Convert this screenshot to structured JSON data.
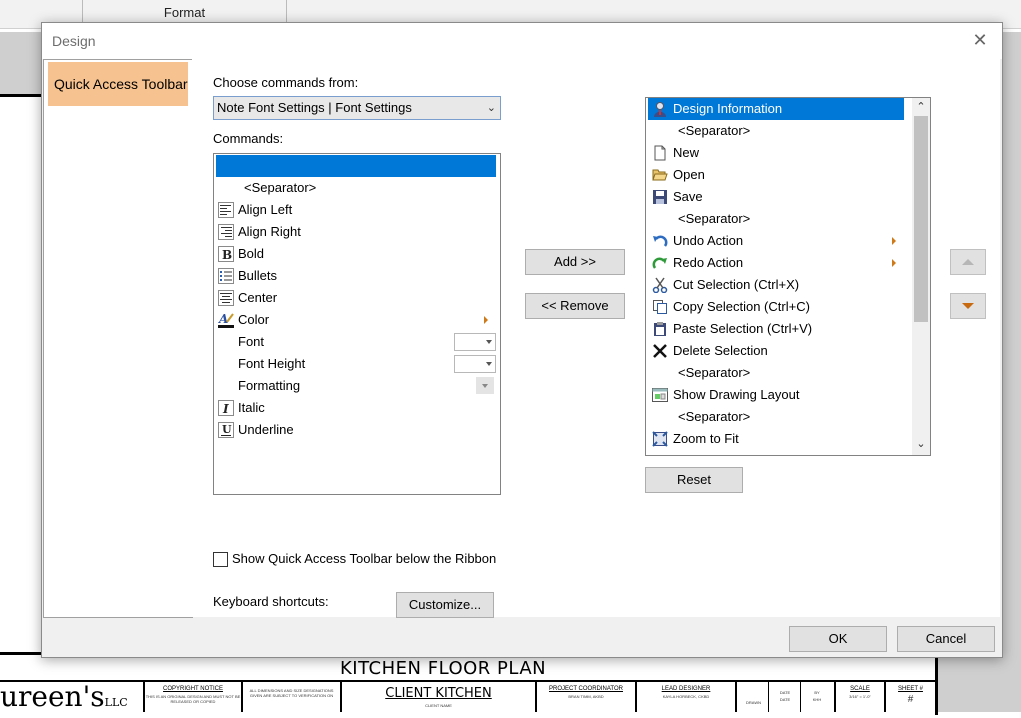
{
  "background": {
    "ribbon_tab": "Format",
    "title_block": {
      "sheet_title": "KITCHEN FLOOR PLAN",
      "logo": "ureen's",
      "logo_suffix": "LLC",
      "copyright_heading": "COPYRIGHT NOTICE",
      "copyright_text": "THIS IS AN ORIGINAL DESIGN AND MUST NOT BE RELEASED OR COPIED",
      "dimensions_text": "ALL DIMENSIONS AND SIZE DESIGNATIONS GIVEN ARE SUBJECT TO VERIFICATION ON",
      "client_name": "CLIENT KITCHEN",
      "client_caption": "CLIENT NAME",
      "coordinator_heading": "PROJECT COORDINATOR",
      "coordinator_name": "BRAN TIMM, AKBD",
      "designer_heading": "LEAD DESIGNER",
      "designer_name": "KAYLA HORBECK, CKBD",
      "date_heading": "DATE",
      "by_heading": "BY",
      "drawn_label": "DRAWN",
      "date_value": "DATE",
      "by_value": "KHH",
      "scale_heading": "SCALE",
      "scale_value": "3/16\" = 1'-0\"",
      "sheet_heading": "SHEET #",
      "sheet_value": "#"
    }
  },
  "dialog": {
    "title": "Design",
    "close_icon": "close-icon",
    "nav": {
      "quick_access_toolbar": "Quick Access Toolbar"
    },
    "choose_commands_label": "Choose commands from:",
    "choose_commands_value": "Note Font Settings | Font Settings",
    "commands_label": "Commands:",
    "commands": [
      {
        "label": "",
        "icon": "",
        "selected": true
      },
      {
        "label": "<Separator>",
        "icon": ""
      },
      {
        "label": "Align Left",
        "icon": "align-left-icon"
      },
      {
        "label": "Align Right",
        "icon": "align-right-icon"
      },
      {
        "label": "Bold",
        "icon": "bold-icon"
      },
      {
        "label": "Bullets",
        "icon": "bullets-icon"
      },
      {
        "label": "Center",
        "icon": "center-align-icon"
      },
      {
        "label": "Color",
        "icon": "font-color-icon",
        "submenu": true
      },
      {
        "label": "Font",
        "icon": "",
        "combo": true
      },
      {
        "label": "Font Height",
        "icon": "",
        "combo": true
      },
      {
        "label": "Formatting",
        "icon": "",
        "dropdown": true
      },
      {
        "label": "Italic",
        "icon": "italic-icon"
      },
      {
        "label": "Underline",
        "icon": "underline-icon"
      }
    ],
    "add_button": "Add >>",
    "remove_button": "<< Remove",
    "toolbar_items": [
      {
        "label": "Design Information",
        "icon": "design-information-icon",
        "selected": true
      },
      {
        "label": "<Separator>",
        "icon": ""
      },
      {
        "label": "New",
        "icon": "new-document-icon"
      },
      {
        "label": "Open",
        "icon": "open-folder-icon"
      },
      {
        "label": "Save",
        "icon": "save-icon"
      },
      {
        "label": "<Separator>",
        "icon": ""
      },
      {
        "label": "Undo Action",
        "icon": "undo-icon",
        "submenu": true
      },
      {
        "label": "Redo Action",
        "icon": "redo-icon",
        "submenu": true
      },
      {
        "label": "Cut Selection (Ctrl+X)",
        "icon": "cut-icon"
      },
      {
        "label": "Copy Selection (Ctrl+C)",
        "icon": "copy-icon"
      },
      {
        "label": "Paste Selection (Ctrl+V)",
        "icon": "paste-icon"
      },
      {
        "label": "Delete Selection",
        "icon": "delete-icon"
      },
      {
        "label": "<Separator>",
        "icon": ""
      },
      {
        "label": "Show Drawing Layout",
        "icon": "drawing-layout-icon"
      },
      {
        "label": "<Separator>",
        "icon": ""
      },
      {
        "label": "Zoom to Fit",
        "icon": "zoom-to-fit-icon"
      }
    ],
    "reset_button": "Reset",
    "move_up_icon": "move-up-icon",
    "move_down_icon": "move-down-icon",
    "show_below_ribbon_label": "Show Quick Access Toolbar below the Ribbon",
    "show_below_ribbon_checked": false,
    "keyboard_shortcuts_label": "Keyboard shortcuts:",
    "customize_button": "Customize...",
    "ok_button": "OK",
    "cancel_button": "Cancel"
  }
}
